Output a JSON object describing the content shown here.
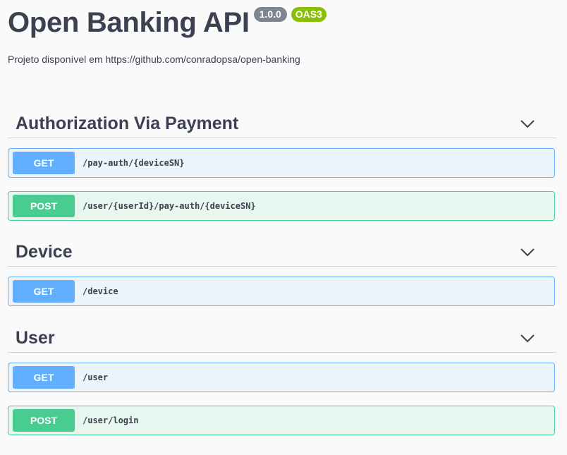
{
  "info": {
    "title": "Open Banking API",
    "version_badge": "1.0.0",
    "oas_badge": "OAS3",
    "description": "Projeto disponível em https://github.com/conradopsa/open-banking"
  },
  "tags": [
    {
      "title": "Authorization Via Payment",
      "operations": [
        {
          "method": "GET",
          "path": "/pay-auth/{deviceSN}"
        },
        {
          "method": "POST",
          "path": "/user/{userId}/pay-auth/{deviceSN}"
        }
      ]
    },
    {
      "title": "Device",
      "operations": [
        {
          "method": "GET",
          "path": "/device"
        }
      ]
    },
    {
      "title": "User",
      "operations": [
        {
          "method": "GET",
          "path": "/user"
        },
        {
          "method": "POST",
          "path": "/user/login"
        }
      ]
    }
  ],
  "colors": {
    "get": "#61affe",
    "post": "#49cc90",
    "version_badge": "#7d8492",
    "oas_badge": "#89bf04"
  },
  "icons": {
    "tag_toggle": "chevron-down-icon"
  }
}
